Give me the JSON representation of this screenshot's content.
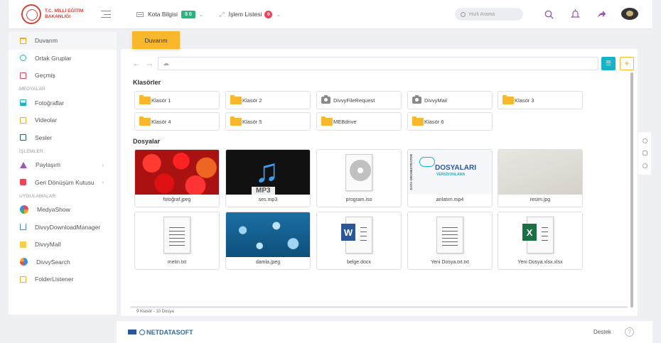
{
  "header": {
    "logo_line1": "T.C. MİLLİ EĞİTİM",
    "logo_line2": "BAKANLIĞI",
    "quota_label": "Kota Bilgisi",
    "quota_badge": "$ 0",
    "ops_label": "İşlem Listesi",
    "ops_badge": "0",
    "search_placeholder": "Hızlı Arama"
  },
  "sidebar": {
    "items": [
      {
        "label": "Duvarım"
      },
      {
        "label": "Ortak Gruplar"
      },
      {
        "label": "Geçmiş"
      }
    ],
    "section_media": "MEDYALAR",
    "media": [
      {
        "label": "Fotoğraflar"
      },
      {
        "label": "Videolar"
      },
      {
        "label": "Sesler"
      }
    ],
    "section_ops": "İŞLEMLER",
    "ops": [
      {
        "label": "Paylaşım"
      },
      {
        "label": "Geri Dönüşüm Kutusu"
      }
    ],
    "section_apps": "UYGULAMALAR",
    "apps": [
      {
        "label": "MedyaShow"
      },
      {
        "label": "DivvyDownloadManager"
      },
      {
        "label": "DivvyMail"
      },
      {
        "label": "DivvySearch"
      },
      {
        "label": "FolderListener"
      }
    ]
  },
  "main": {
    "tab": "Duvarım",
    "folders_heading": "Klasörler",
    "folders": [
      "Klasör 1",
      "Klasör 2",
      "DivvyFileRequest",
      "DivvyMail",
      "Klasör 3",
      "Klasör 4",
      "Klasör 5",
      "MEBdrive",
      "Klasör 6"
    ],
    "files_heading": "Dosyalar",
    "files": [
      "fotoğraf.jpeg",
      "ses.mp3",
      "program.iso",
      "anlatım.mp4",
      "resim.jpg",
      "metin.txt",
      "damla.jpeg",
      "belge.docx",
      "Yeni Dosya.txt.txt",
      "Yeni Dosya.xlsx.xlsx"
    ],
    "mp3_label": "MP3",
    "edu_side": "DATA ORCHESTRATOR",
    "edu_title": "DOSYALARI",
    "edu_sub": "VERSİYONLAMA",
    "footer_count": "9 Klasör - 10 Dosya"
  },
  "footer": {
    "brand": "NETDATASOFT",
    "support": "Destek",
    "help": "?"
  }
}
